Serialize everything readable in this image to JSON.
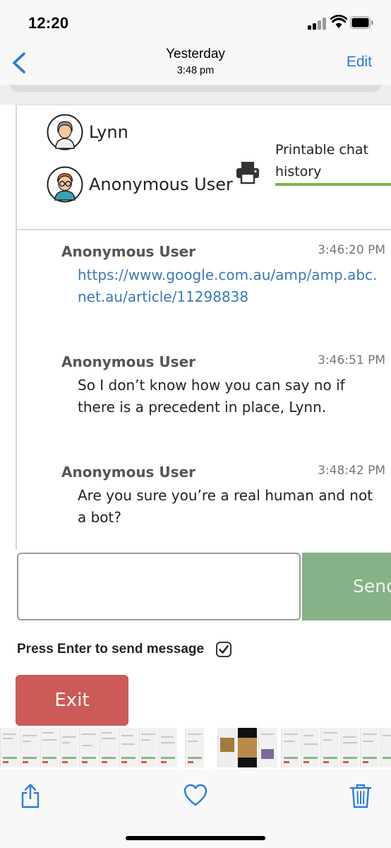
{
  "status_bar": {
    "time": "12:20",
    "icons": [
      "signal-icon",
      "wifi-icon",
      "battery-icon"
    ]
  },
  "nav": {
    "back_icon": "chevron-left-icon",
    "title": "Yesterday",
    "subtitle": "3:48 pm",
    "edit_label": "Edit",
    "accent_color": "#2a7ae2"
  },
  "chat": {
    "participants": [
      {
        "name": "Lynn",
        "icon": "avatar-grey-hair-icon"
      },
      {
        "name": "Anonymous User",
        "icon": "avatar-red-hair-glasses-icon"
      }
    ],
    "print": {
      "icon": "printer-icon",
      "label": "Printable chat history",
      "underline_color": "#7ab648"
    },
    "messages": [
      {
        "sender": "Anonymous User",
        "time": "3:46:20 PM",
        "text": "https://www.google.com.au/amp/amp.abc.net.au/article/11298838",
        "is_link": true
      },
      {
        "sender": "Anonymous User",
        "time": "3:46:51 PM",
        "text": "So I don’t know how you can say no if there is a precedent in place, Lynn.",
        "is_link": false
      },
      {
        "sender": "Anonymous User",
        "time": "3:48:42 PM",
        "text": "Are you sure you’re a real human and not a bot?",
        "is_link": false
      }
    ],
    "input": {
      "value": "",
      "placeholder": ""
    },
    "send_label": "Send",
    "send_color": "#87b187",
    "enter_label": "Press Enter to send message",
    "enter_checked": true,
    "exit_label": "Exit",
    "exit_color": "#cc5a56"
  },
  "toolbar": {
    "share_icon": "share-icon",
    "favorite_icon": "heart-icon",
    "delete_icon": "trash-icon"
  }
}
